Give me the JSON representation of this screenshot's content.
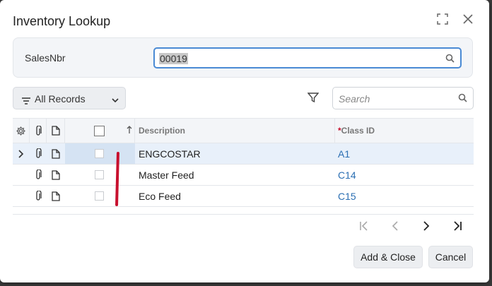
{
  "dialog": {
    "title": "Inventory Lookup"
  },
  "params": {
    "label": "SalesNbr",
    "value": "00019"
  },
  "toolbar": {
    "filter_label": "All Records",
    "search_placeholder": "Search"
  },
  "grid": {
    "columns": {
      "description": "Description",
      "class_id_required": "*",
      "class_id": "Class ID"
    },
    "rows": [
      {
        "description": "ENGCOSTAR",
        "class_id": "A1",
        "selected": true
      },
      {
        "description": "Master Feed",
        "class_id": "C14",
        "selected": false
      },
      {
        "description": "Eco Feed",
        "class_id": "C15",
        "selected": false
      }
    ]
  },
  "buttons": {
    "add_close": "Add & Close",
    "cancel": "Cancel"
  },
  "colors": {
    "accent": "#4a8ad4",
    "link": "#2b6fb3",
    "required": "#c8102e",
    "annotation": "#c8102e"
  }
}
